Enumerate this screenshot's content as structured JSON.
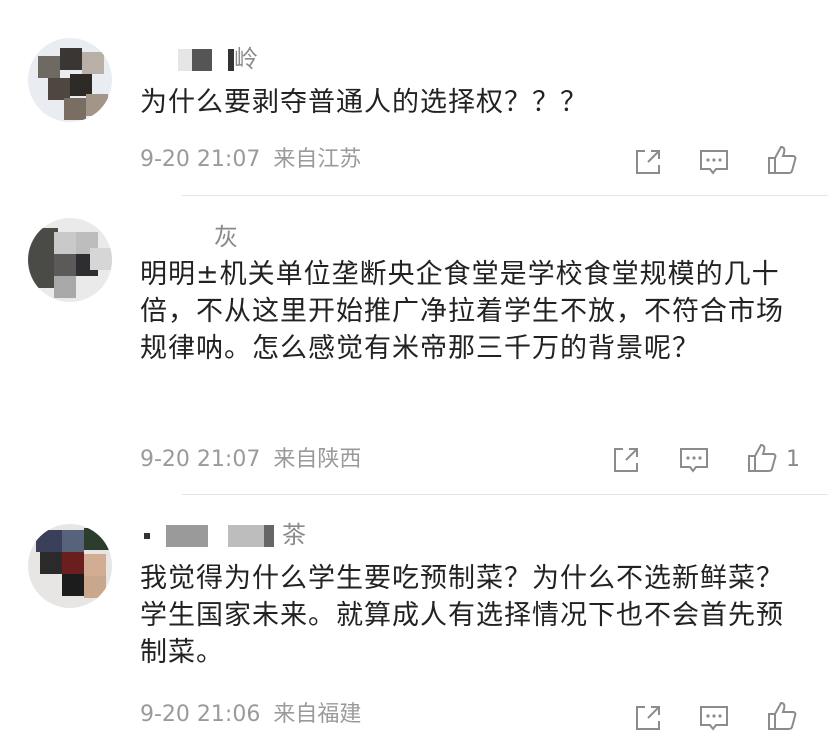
{
  "comments": [
    {
      "username_visible": "岭",
      "text": "为什么要剥夺普通人的选择权？？？",
      "time": "9-20 21:07",
      "location": "来自江苏",
      "likes": ""
    },
    {
      "username_visible": "灰",
      "text": "明明±机关单位垄断央企食堂是学校食堂规模的几十倍，不从这里开始推广净拉着学生不放，不符合市场规律呐。怎么感觉有米帝那三千万的背景呢？",
      "time": "9-20 21:07",
      "location": "来自陕西",
      "likes": "1"
    },
    {
      "username_visible": "茶",
      "text": "我觉得为什么学生要吃预制菜？为什么不选新鲜菜？学生国家未来。就算成人有选择情况下也不会首先预制菜。",
      "time": "9-20 21:06",
      "location": "来自福建",
      "likes": ""
    }
  ],
  "icons": {
    "share": "share-icon",
    "comment": "comment-icon",
    "like": "thumbs-up-icon"
  },
  "colors": {
    "text": "#222222",
    "meta": "#9a9a9a",
    "icon": "#8c8c8c",
    "divider": "#e6e6e6"
  }
}
